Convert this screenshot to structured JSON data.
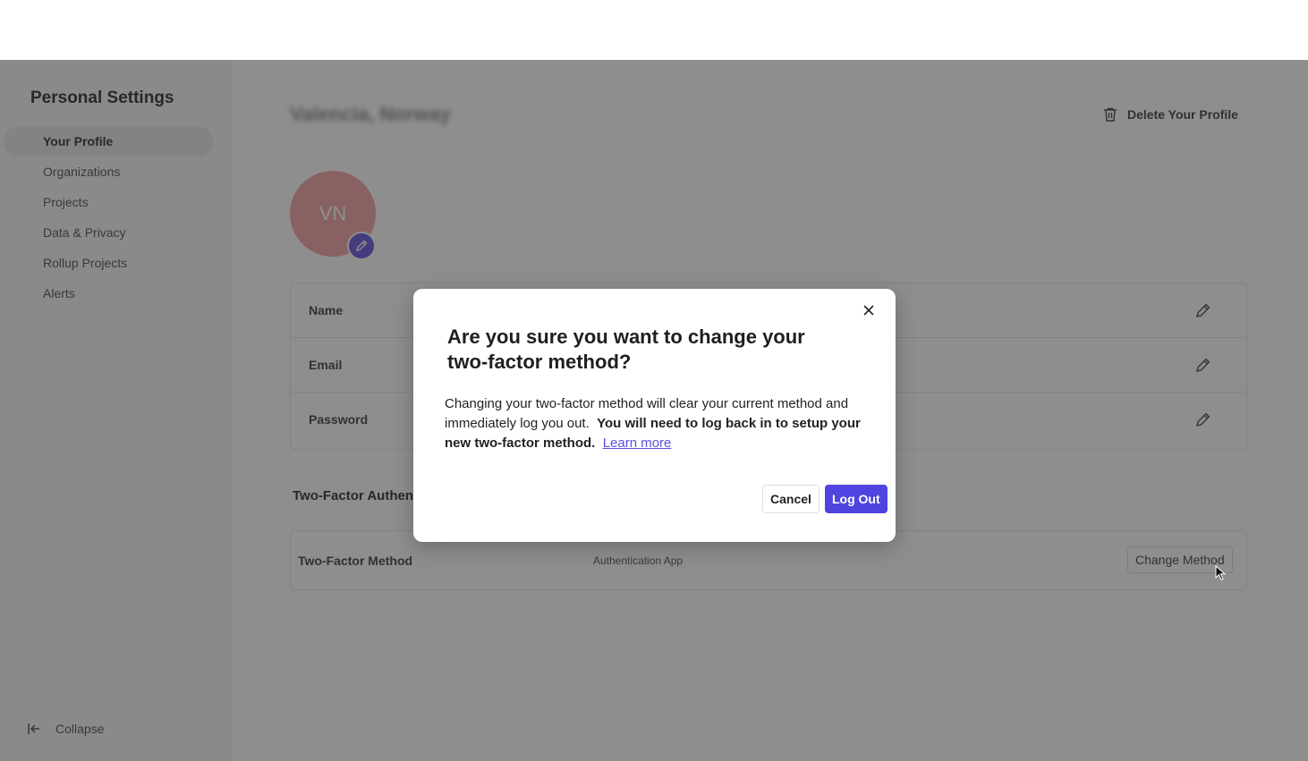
{
  "sidebar": {
    "title": "Personal Settings",
    "items": [
      {
        "label": "Your Profile",
        "active": true
      },
      {
        "label": "Organizations"
      },
      {
        "label": "Projects"
      },
      {
        "label": "Data & Privacy"
      },
      {
        "label": "Rollup Projects"
      },
      {
        "label": "Alerts"
      }
    ],
    "collapse_label": "Collapse"
  },
  "profile": {
    "name": "Valencia, Norway",
    "subtitle": "",
    "initials": "VN",
    "delete_label": "Delete Your Profile",
    "avatar_color": "#f2a7a7"
  },
  "fields": [
    {
      "label": "Name"
    },
    {
      "label": "Email"
    },
    {
      "label": "Password"
    }
  ],
  "two_factor": {
    "heading": "Two-Factor Authentication",
    "method_label": "Two-Factor Method",
    "method_value": "Authentication App",
    "change_button": "Change Method"
  },
  "modal": {
    "title": "Are you sure you want to change your two-factor method?",
    "body_normal": "Changing your two-factor method will clear your current method and immediately log you out.",
    "body_bold": "You will need to log back in to setup your new two-factor method.",
    "link_label": "Learn more",
    "cancel_label": "Cancel",
    "confirm_label": "Log Out",
    "accent_color": "#4f44e0"
  }
}
